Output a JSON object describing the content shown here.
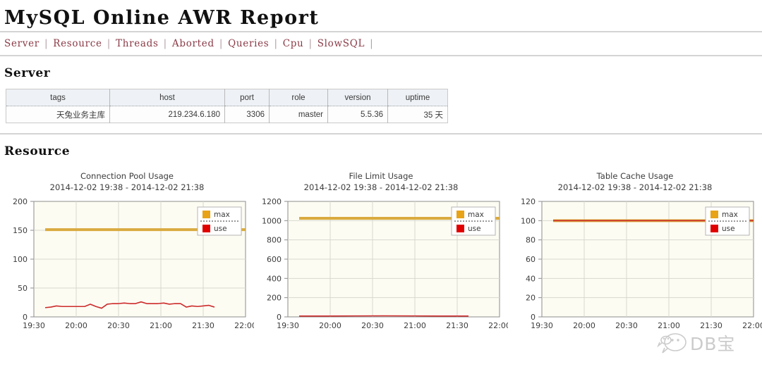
{
  "header": {
    "title": "MySQL Online AWR Report"
  },
  "nav": {
    "separator": "|",
    "items": [
      {
        "label": "Server"
      },
      {
        "label": "Resource"
      },
      {
        "label": "Threads"
      },
      {
        "label": "Aborted"
      },
      {
        "label": "Queries"
      },
      {
        "label": "Cpu"
      },
      {
        "label": "SlowSQL"
      }
    ]
  },
  "sections": {
    "server": {
      "heading": "Server"
    },
    "resource": {
      "heading": "Resource"
    }
  },
  "server_table": {
    "columns": [
      "tags",
      "host",
      "port",
      "role",
      "version",
      "uptime"
    ],
    "rows": [
      {
        "tags": "天兔业务主库",
        "host": "219.234.6.180",
        "port": "3306",
        "role": "master",
        "version": "5.5.36",
        "uptime": "35 天"
      }
    ]
  },
  "colors": {
    "max": "#e8a317",
    "max_line": "#d9aa3f",
    "use": "#e00000",
    "use_line": "#cc2b2b",
    "plot_bg": "#fdfcf3",
    "grid": "#d8d8cf",
    "axis": "#8c8c8c",
    "nav_link": "#8a3a46",
    "rule": "#d4d4d4"
  },
  "watermark": {
    "text": "DB宝",
    "icon": "wechat-icon"
  },
  "chart_data": [
    {
      "type": "line",
      "title": "Connection Pool Usage",
      "subtitle": "2014-12-02 19:38 - 2014-12-02 21:38",
      "xlabel": "",
      "ylabel": "",
      "ylim": [
        0,
        200
      ],
      "yticks": [
        0,
        50,
        100,
        150,
        200
      ],
      "xticks": [
        "19:30",
        "20:00",
        "20:30",
        "21:00",
        "21:30",
        "22:00"
      ],
      "xlim_minutes": [
        1170,
        1320
      ],
      "grid": true,
      "legend": [
        "max",
        "use"
      ],
      "legend_position": "top-right",
      "series": [
        {
          "name": "max",
          "color": "#d9aa3f",
          "x": [
            1178,
            1320
          ],
          "values": [
            151,
            151
          ]
        },
        {
          "name": "use",
          "color": "#cc2b2b",
          "x": [
            1178,
            1182,
            1186,
            1190,
            1194,
            1198,
            1202,
            1206,
            1210,
            1214,
            1218,
            1222,
            1226,
            1230,
            1234,
            1238,
            1242,
            1246,
            1250,
            1254,
            1258,
            1262,
            1266,
            1270,
            1274,
            1278,
            1282,
            1286,
            1290,
            1294,
            1298
          ],
          "values": [
            16,
            17,
            19,
            18,
            18,
            18,
            18,
            18,
            22,
            18,
            15,
            22,
            23,
            23,
            24,
            23,
            23,
            26,
            23,
            23,
            23,
            24,
            22,
            23,
            23,
            17,
            19,
            18,
            19,
            20,
            17
          ]
        }
      ]
    },
    {
      "type": "line",
      "title": "File Limit Usage",
      "subtitle": "2014-12-02 19:38 - 2014-12-02 21:38",
      "xlabel": "",
      "ylabel": "",
      "ylim": [
        0,
        1200
      ],
      "yticks": [
        0,
        200,
        400,
        600,
        800,
        1000,
        1200
      ],
      "xticks": [
        "19:30",
        "20:00",
        "20:30",
        "21:00",
        "21:30",
        "22:00"
      ],
      "xlim_minutes": [
        1170,
        1320
      ],
      "grid": true,
      "legend": [
        "max",
        "use"
      ],
      "legend_position": "top-right",
      "series": [
        {
          "name": "max",
          "color": "#d9aa3f",
          "x": [
            1178,
            1320
          ],
          "values": [
            1024,
            1024
          ]
        },
        {
          "name": "use",
          "color": "#cc2b2b",
          "x": [
            1178,
            1198,
            1218,
            1238,
            1258,
            1278,
            1298
          ],
          "values": [
            9,
            9,
            10,
            11,
            10,
            9,
            9
          ]
        }
      ]
    },
    {
      "type": "line",
      "title": "Table Cache Usage",
      "subtitle": "2014-12-02 19:38 - 2014-12-02 21:38",
      "xlabel": "",
      "ylabel": "",
      "ylim": [
        0,
        120
      ],
      "yticks": [
        0,
        20,
        40,
        60,
        80,
        100,
        120
      ],
      "xticks": [
        "19:30",
        "20:00",
        "20:30",
        "21:00",
        "21:30",
        "22:00"
      ],
      "xlim_minutes": [
        1170,
        1320
      ],
      "grid": true,
      "legend": [
        "max",
        "use"
      ],
      "legend_position": "top-right",
      "series": [
        {
          "name": "max",
          "color": "#d9aa3f",
          "x": [
            1178,
            1320
          ],
          "values": [
            100,
            100
          ]
        },
        {
          "name": "use",
          "color": "#cc2b2b",
          "x": [
            1178,
            1320
          ],
          "values": [
            100,
            100
          ]
        }
      ]
    }
  ]
}
